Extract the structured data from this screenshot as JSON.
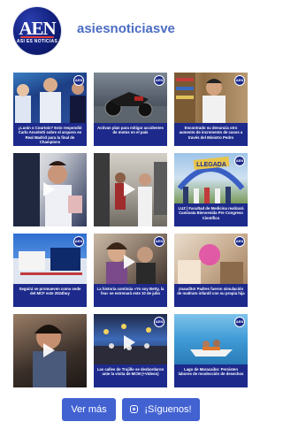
{
  "profile": {
    "logo_text": "AEN",
    "logo_subtext": "ASI ES NOTICIAS",
    "handle": "asiesnoticiasve"
  },
  "posts": [
    {
      "caption": "¿Lunin o Courtois? Esto respondió Carlo Ancelotti sobre el arquero en Real Madrid para la final de Champions",
      "type": "image",
      "badge": "AEN"
    },
    {
      "caption": "Activan plan para mitigar accidentes de motos en el país",
      "type": "image",
      "badge": "AEN"
    },
    {
      "caption": "Encontrado su denuncia otro aumento de incremento de casos a través del Ministro Pedro",
      "type": "image",
      "badge": "AEN"
    },
    {
      "caption": "",
      "type": "video",
      "badge": ""
    },
    {
      "caption": "",
      "type": "video",
      "badge": ""
    },
    {
      "caption": "LUZ | Facultad de Medicina realizará Caminata Bienvenida Pre Congreso Científico",
      "type": "image",
      "badge": "AEN",
      "banner": "LLEGADA"
    },
    {
      "caption": "Seguirá se promueven como sede del MCF este 2024hoy",
      "type": "image",
      "badge": "AEN"
    },
    {
      "caption": "La historia continúa «Yo soy Betty, la fea» se estrenará este 10 de julio",
      "type": "video",
      "badge": "AEN"
    },
    {
      "caption": "¡Inaudito! Padres fueron simulación de maltrato infantil con su propia hija",
      "type": "image",
      "badge": "AEN"
    },
    {
      "caption": "",
      "type": "video",
      "badge": ""
    },
    {
      "caption": "Las calles de Trujillo se desbordaron ante la visita de MCM (+Videos)",
      "type": "video",
      "badge": "AEN"
    },
    {
      "caption": "Lago de Maracaibo: Persisten labores de recolección de desechos",
      "type": "image",
      "badge": "AEN"
    }
  ],
  "buttons": {
    "more_label": "Ver más",
    "follow_label": "¡Síguenos!"
  },
  "colors": {
    "accent": "#4262d2",
    "caption_bg": "#1d2a8c",
    "handle": "#4b6cc4"
  }
}
